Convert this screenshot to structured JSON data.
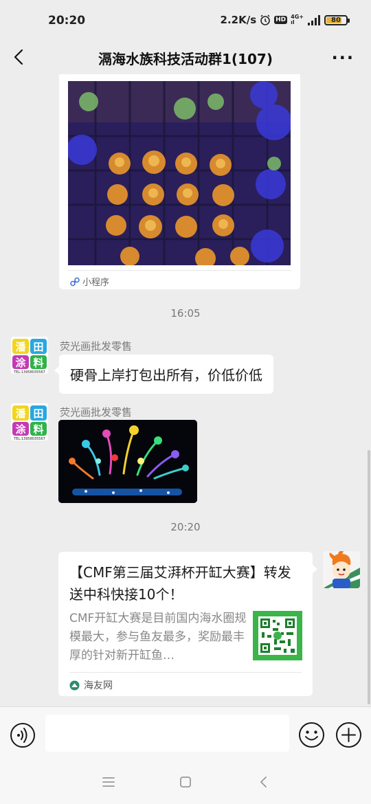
{
  "status_bar": {
    "time": "20:20",
    "net_speed": "2.2K/s",
    "hd_label": "HD",
    "network_top": "4G+",
    "network_bottom": "ıl",
    "battery": "80",
    "battery_level": 0.8
  },
  "header": {
    "title": "滆海水族科技活动群1(107)",
    "more_label": "···"
  },
  "messages": [
    {
      "type": "mini_program_card",
      "source_label": "小程序"
    },
    {
      "type": "timestamp",
      "text": "16:05"
    },
    {
      "type": "text",
      "sender": "荧光画批发零售",
      "text": "硬骨上岸打包出所有，价低价低",
      "avatar_lines": [
        "潘田",
        "涂料"
      ],
      "avatar_phone": "TEL:13958035567"
    },
    {
      "type": "image",
      "sender": "荧光画批发零售",
      "avatar_lines": [
        "潘田",
        "涂料"
      ],
      "avatar_phone": "TEL:13958035567"
    },
    {
      "type": "timestamp",
      "text": "20:20"
    },
    {
      "type": "link_card",
      "title": "【CMF第三届艾湃杯开缸大赛】转发送中科快接10个！",
      "description": "CMF开缸大赛是目前国内海水圈规模最大，参与鱼友最多，奖励最丰厚的针对新开缸鱼…",
      "source": "海友网"
    }
  ],
  "input_bar": {
    "placeholder": "",
    "voice_icon": "voice-icon",
    "emoji_icon": "emoji-icon",
    "plus_icon": "plus-icon"
  },
  "colors": {
    "background": "#ededed",
    "bubble": "#ffffff",
    "accent_green": "#07c160"
  }
}
